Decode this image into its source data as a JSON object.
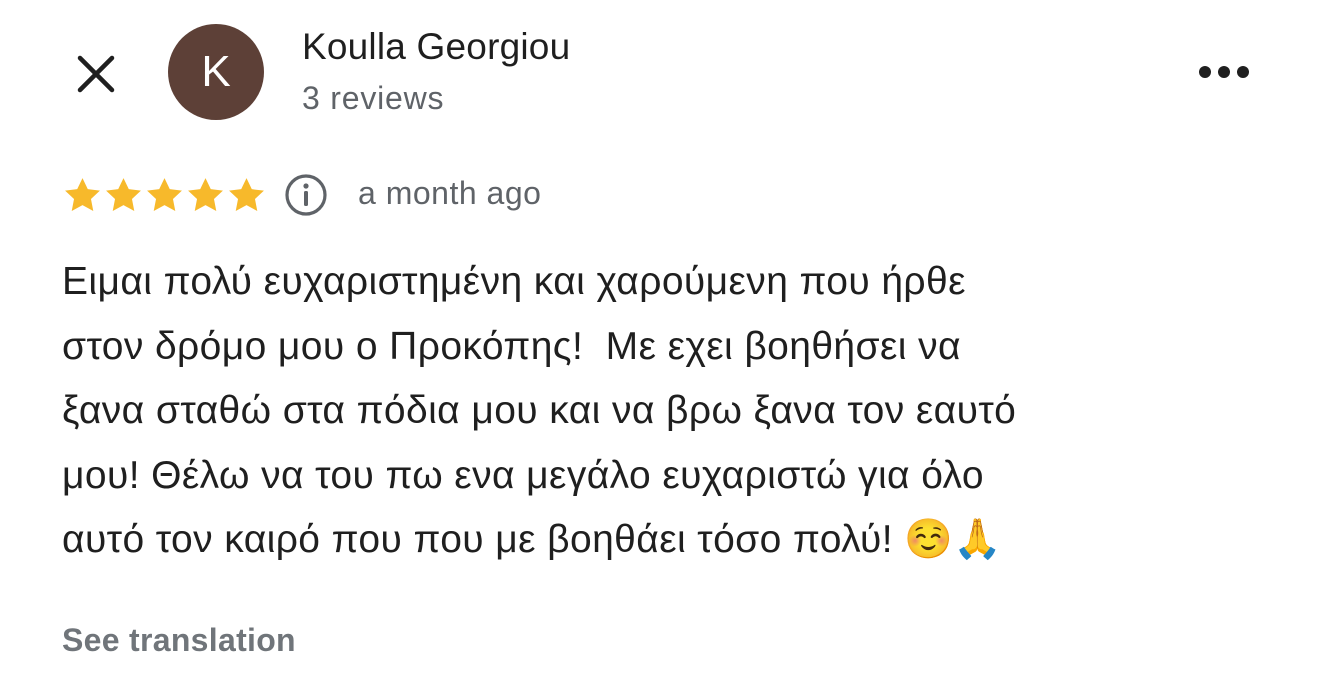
{
  "header": {
    "close_icon": "close-icon",
    "avatar_initial": "K",
    "avatar_color": "#5d4037",
    "user_name": "Koulla Georgiou",
    "review_count": "3 reviews",
    "more_icon": "more-horizontal-icon"
  },
  "review": {
    "rating": 5,
    "max_rating": 5,
    "star_color": "#f7b92b",
    "info_icon": "info-icon",
    "date": "a month ago",
    "text": "Ειμαι πολύ ευχαριστημένη και χαρούμενη που ήρθε\nστον δρόμο μου ο Προκόπης!  Με εχει βοηθήσει να\nξανα σταθώ στα πόδια μου και να βρω ξανα τον εαυτό\nμου! Θέλω να του πω ενα μεγάλο ευχαριστώ για όλο\nαυτό τον καιρό που που με βοηθάει τόσο πολύ! ☺️🙏",
    "see_translation": "See translation"
  }
}
